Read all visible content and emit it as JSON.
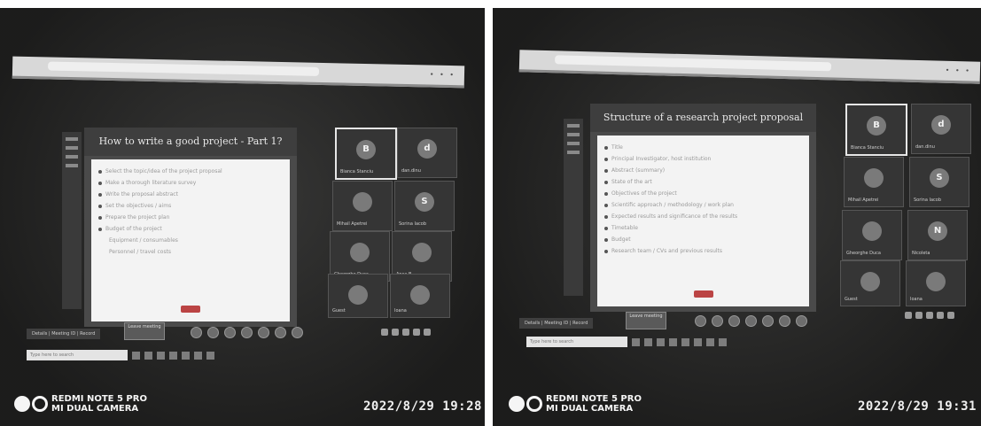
{
  "photos": [
    {
      "slide": {
        "title": "How to write a good project - Part 1?",
        "bullets": [
          "Select the topic/idea of the project proposal",
          "Make a thorough literature survey",
          "Write the proposal abstract",
          "Set the objectives / aims",
          "Prepare the project plan",
          "Budget of the project",
          "Equipment / consumables",
          "Personnel / travel costs"
        ]
      },
      "participants": [
        {
          "initial": "B",
          "name": "Bianca Stanciu"
        },
        {
          "initial": "d",
          "name": "dan.dinu"
        },
        {
          "initial": "",
          "name": "Mihail Apetrei"
        },
        {
          "initial": "S",
          "name": "Sorina Iacob"
        },
        {
          "initial": "",
          "name": "Gheorghe Duca"
        },
        {
          "initial": "",
          "name": "Anca B."
        },
        {
          "initial": "",
          "name": "Guest"
        },
        {
          "initial": "",
          "name": "Ioana"
        }
      ],
      "meeting_info": "Details | Meeting ID | Record",
      "leave_label": "Leave meeting",
      "search_placeholder": "Type here to search",
      "watermark": {
        "line1": "REDMI NOTE 5 PRO",
        "line2": "MI DUAL CAMERA"
      },
      "timestamp": "2022/8/29  19:28"
    },
    {
      "slide": {
        "title": "Structure of a research project proposal",
        "bullets": [
          "Title",
          "Principal Investigator, host institution",
          "Abstract (summary)",
          "State of the art",
          "Objectives of the project",
          "Scientific approach / methodology / work plan",
          "Expected results and significance of the results",
          "Timetable",
          "Budget",
          "Research team / CVs and previous results"
        ]
      },
      "participants": [
        {
          "initial": "B",
          "name": "Bianca Stanciu"
        },
        {
          "initial": "d",
          "name": "dan.dinu"
        },
        {
          "initial": "",
          "name": "Mihail Apetrei"
        },
        {
          "initial": "S",
          "name": "Sorina Iacob"
        },
        {
          "initial": "",
          "name": "Gheorghe Duca"
        },
        {
          "initial": "N",
          "name": "Nicoleta"
        },
        {
          "initial": "",
          "name": "Guest"
        },
        {
          "initial": "",
          "name": "Ioana"
        }
      ],
      "meeting_info": "Details | Meeting ID | Record",
      "leave_label": "Leave meeting",
      "search_placeholder": "Type here to search",
      "watermark": {
        "line1": "REDMI NOTE 5 PRO",
        "line2": "MI DUAL CAMERA"
      },
      "timestamp": "2022/8/29  19:31"
    }
  ]
}
